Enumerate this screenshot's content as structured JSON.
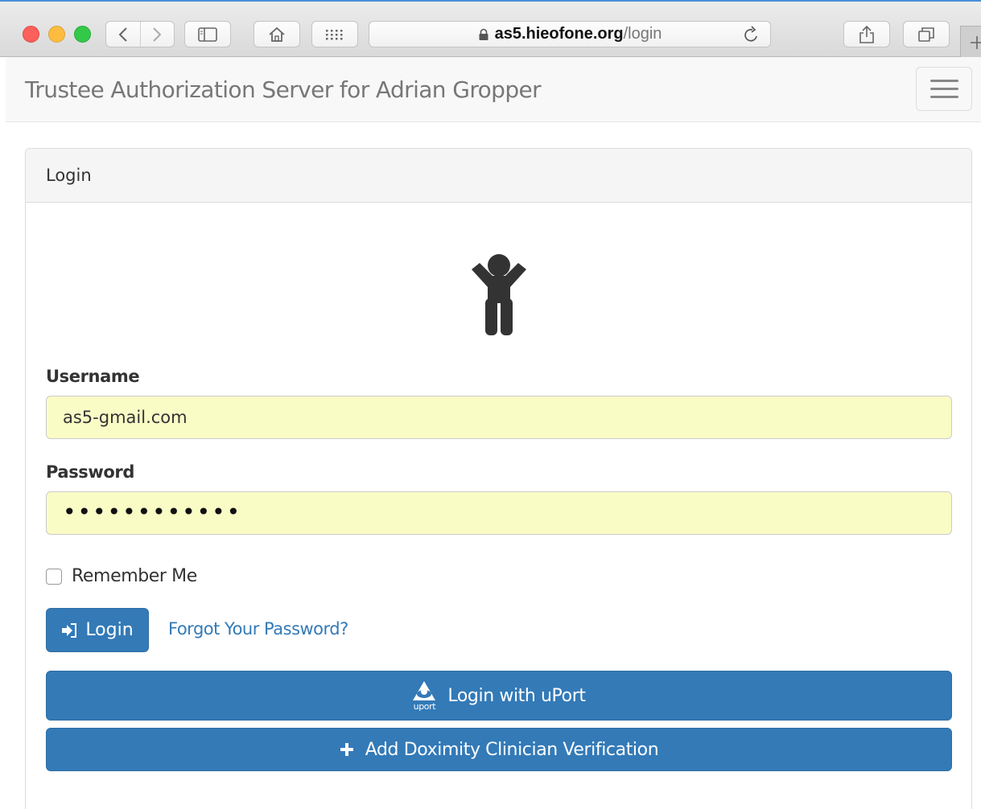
{
  "browser": {
    "url_host": "as5.hieofone.org",
    "url_path": "/login",
    "icons": [
      "back-icon",
      "forward-icon",
      "sidebar-icon",
      "home-icon",
      "grid-icon",
      "lock-icon",
      "reload-icon",
      "share-icon",
      "tabs-icon",
      "plus-icon"
    ]
  },
  "navbar": {
    "brand": "Trustee Authorization Server for Adrian Gropper"
  },
  "panel": {
    "heading": "Login"
  },
  "form": {
    "username_label": "Username",
    "username_value": "as5-gmail.com",
    "password_label": "Password",
    "password_value": "••••••••••••",
    "remember_label": "Remember Me",
    "login_label": "Login",
    "forgot_label": "Forgot Your Password?",
    "uport_label": "Login with uPort",
    "uport_icon_text": "uport",
    "doximity_label": "Add Doximity Clinician Verification"
  },
  "colors": {
    "primary": "#337ab7",
    "autofill": "#fafcc6",
    "brand_text": "#777777"
  }
}
